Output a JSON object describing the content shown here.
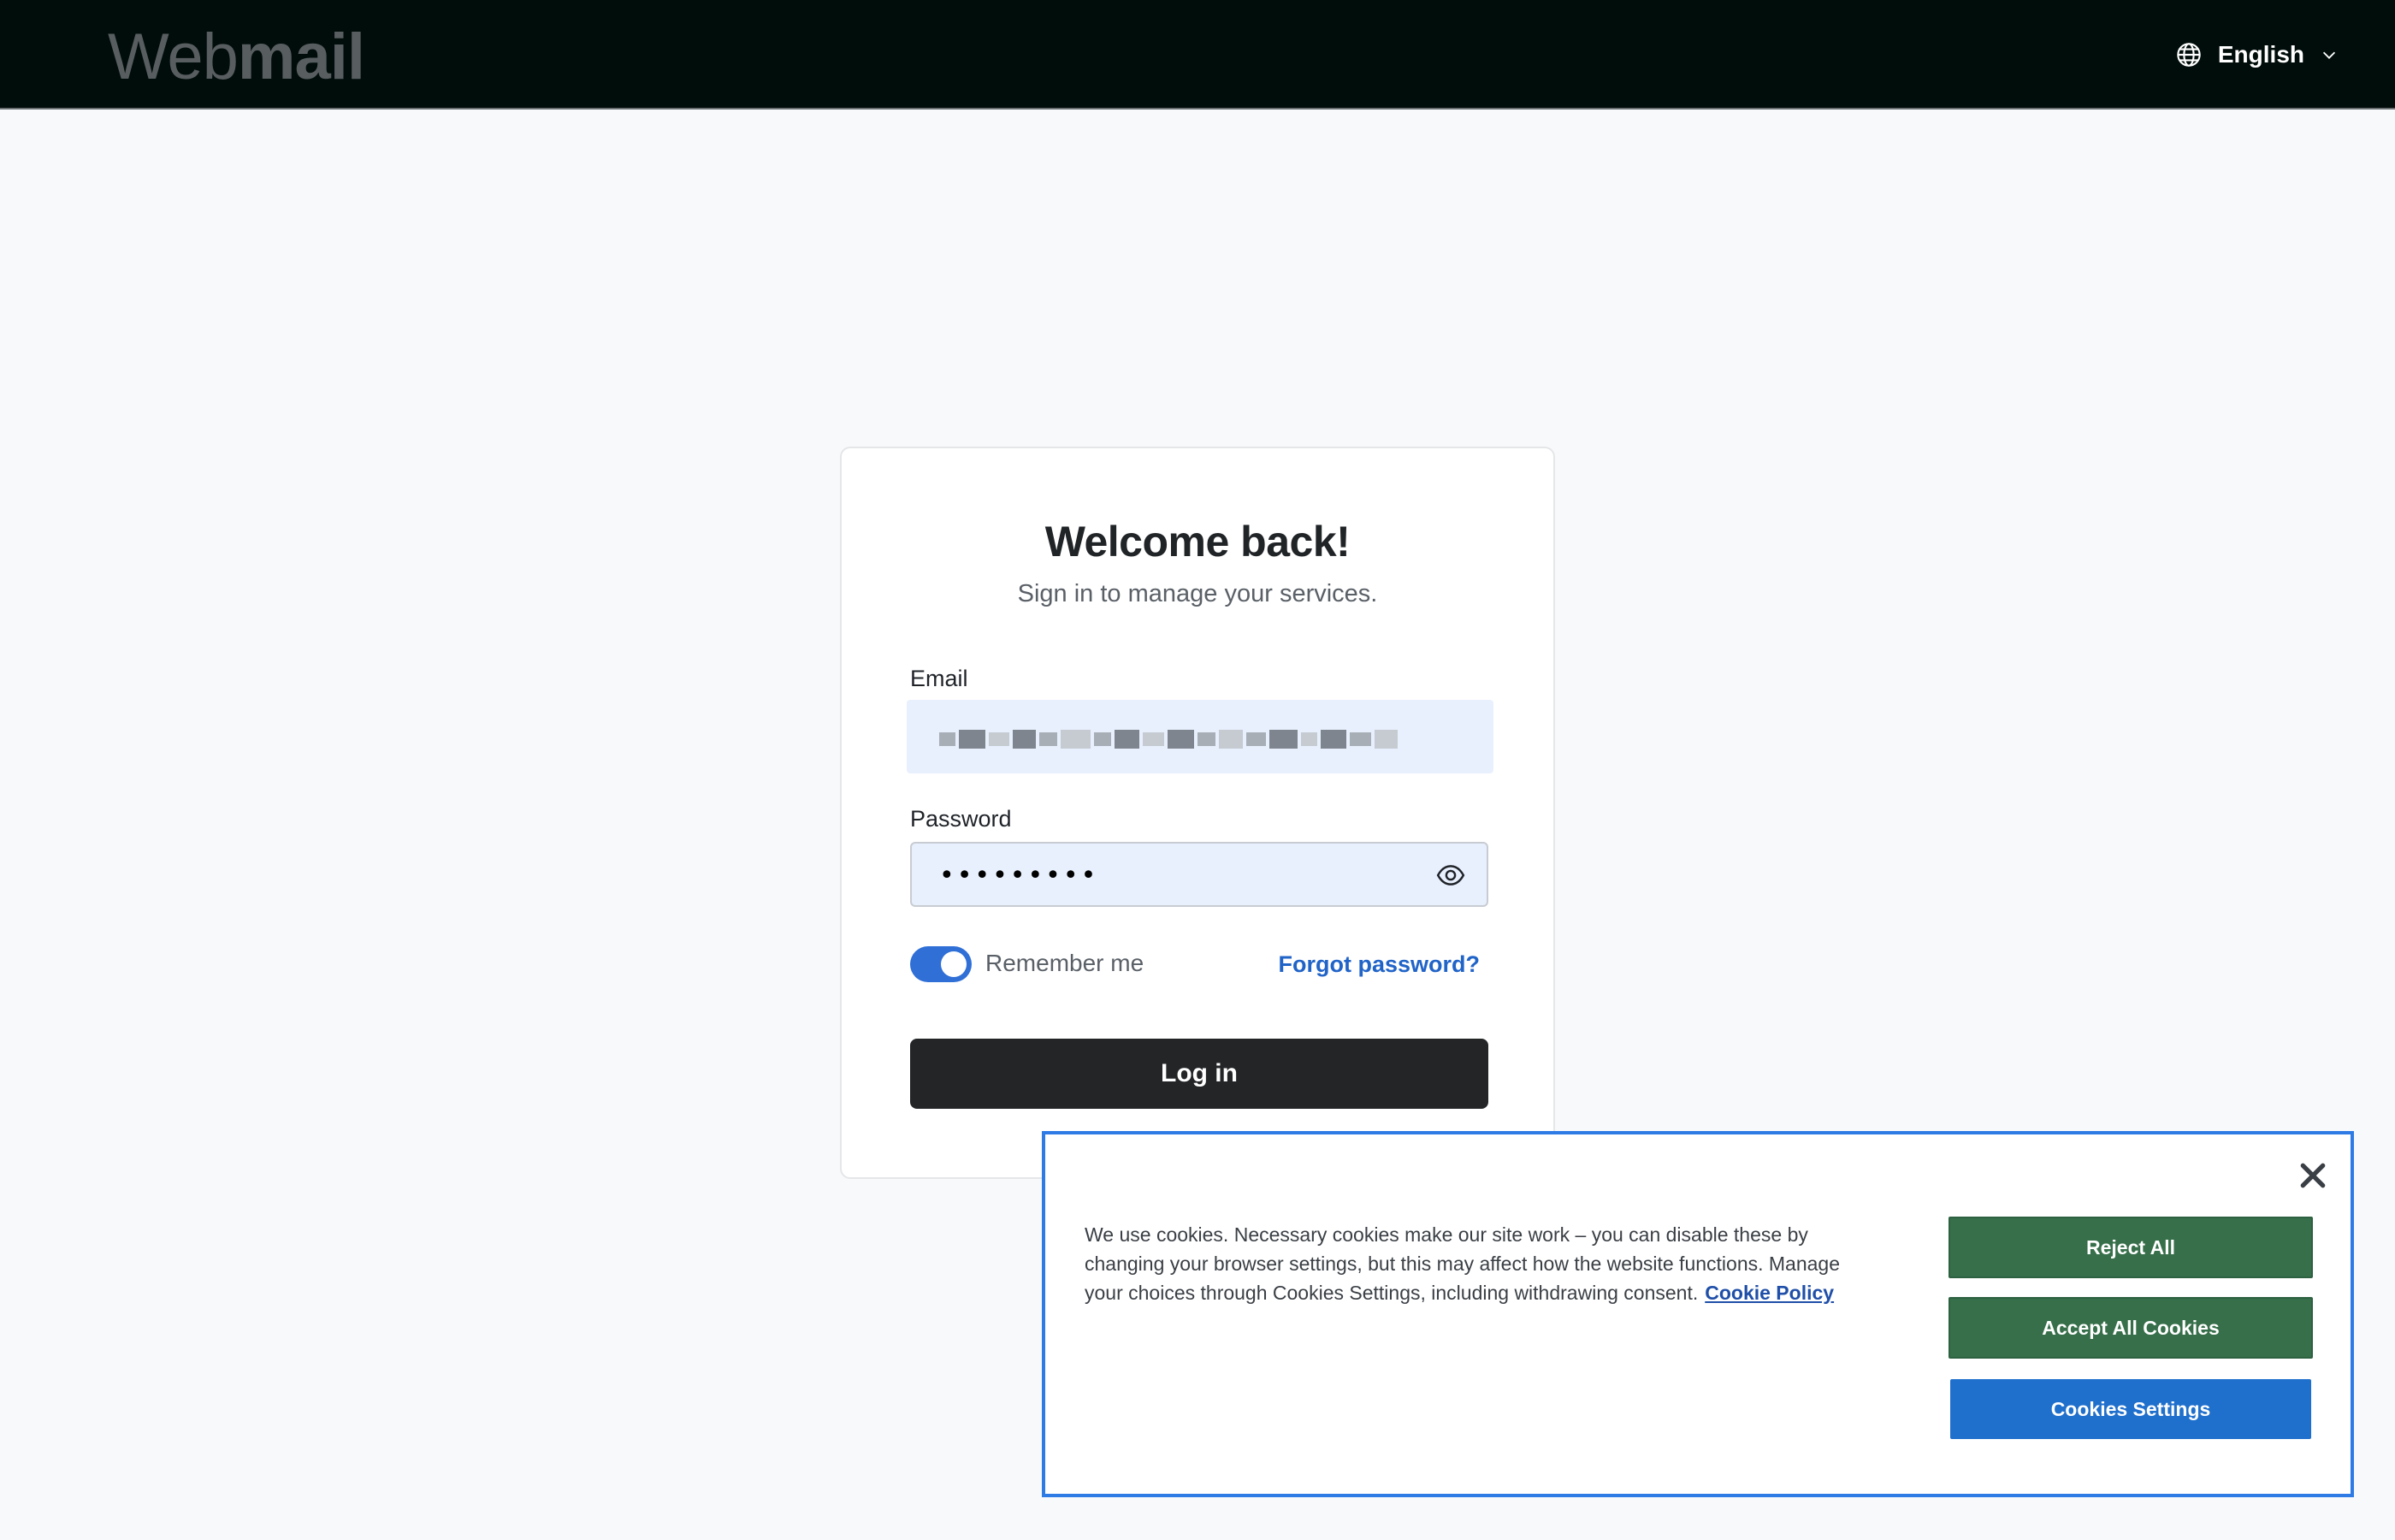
{
  "header": {
    "logo_light": "Web",
    "logo_bold": "mail",
    "language_label": "English"
  },
  "login": {
    "title": "Welcome back!",
    "subtitle": "Sign in to manage your services.",
    "email_label": "Email",
    "password_label": "Password",
    "password_value": "•••••••••",
    "remember_label": "Remember me",
    "remember_checked": true,
    "forgot_label": "Forgot password?",
    "submit_label": "Log in"
  },
  "cookie_banner": {
    "text": "We use cookies. Necessary cookies make our site work – you can disable these by changing your browser settings, but this may affect how the website functions. Manage your choices through Cookies Settings, including withdrawing consent.",
    "policy_link": "Cookie Policy",
    "reject_label": "Reject All",
    "accept_label": "Accept All Cookies",
    "settings_label": "Cookies Settings"
  },
  "colors": {
    "header_bg": "#000d0a",
    "toggle_on": "#2f6fd6",
    "link": "#2164c8",
    "primary_button": "#232527",
    "cookie_green": "#366f4a",
    "cookie_blue": "#1f6fcc",
    "cookie_border": "#2e7be6"
  },
  "icons": {
    "language": "globe-icon",
    "language_toggle": "chevron-down-icon",
    "password_visibility": "eye-icon",
    "close": "close-icon"
  }
}
